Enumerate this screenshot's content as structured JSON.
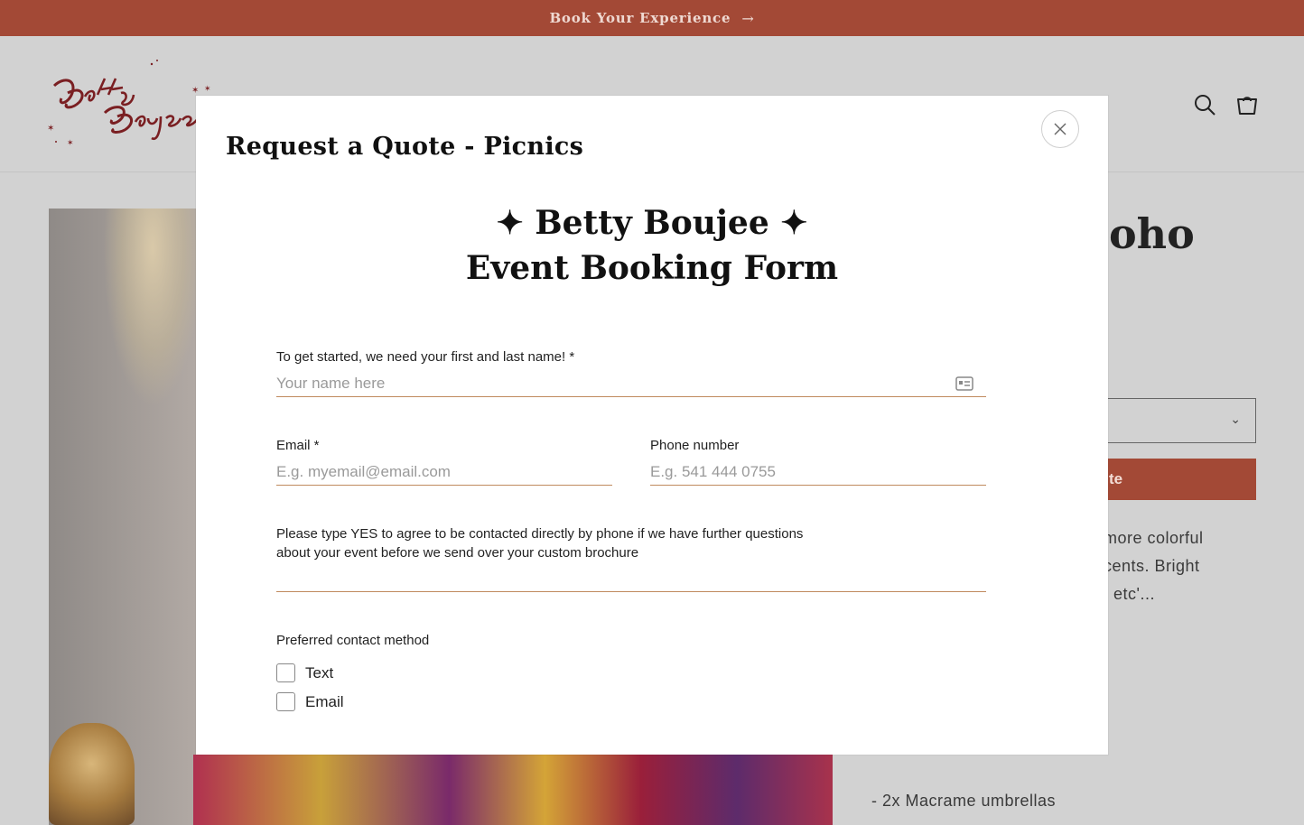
{
  "announcement": {
    "text": "Book Your Experience",
    "arrow": "→"
  },
  "header": {
    "logo_alt": "Betty Boujee",
    "search_icon": "search-icon",
    "cart_icon": "cart-icon"
  },
  "background": {
    "product_title_fragment": "oho",
    "quote_button_fragment": "te",
    "description_lines": [
      "more colorful",
      "cents. Bright",
      "; etc'..."
    ],
    "list_lines": [
      "- 2x Macrame umbrellas"
    ]
  },
  "modal": {
    "title": "Request a Quote - Picnics",
    "close_icon": "close-icon",
    "heading_line1": "✦ Betty Boujee ✦",
    "heading_line2": "Event Booking Form",
    "name": {
      "label": "To get started, we need your first and last name! *",
      "placeholder": "Your name here",
      "value": ""
    },
    "email": {
      "label": "Email *",
      "placeholder": "E.g. myemail@email.com",
      "value": ""
    },
    "phone": {
      "label": "Phone number",
      "placeholder": "E.g. 541 444 0755",
      "value": ""
    },
    "consent": {
      "label_line1": "Please type YES to agree to be contacted directly by phone if we have further questions",
      "label_line2": "about your event before we send over your custom brochure",
      "value": ""
    },
    "contact_method": {
      "label": "Preferred contact method",
      "options": [
        {
          "label": "Text",
          "checked": false
        },
        {
          "label": "Email",
          "checked": false
        }
      ]
    }
  },
  "colors": {
    "brand": "#a34936",
    "field_underline": "#c08a5e",
    "overlay": "#d2d2d2"
  }
}
